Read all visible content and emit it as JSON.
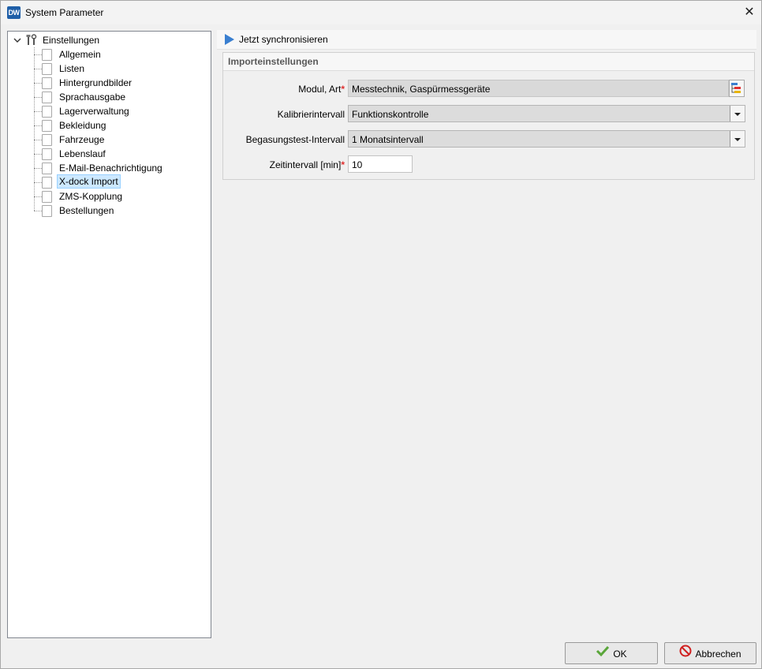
{
  "window": {
    "app_icon_text": "DW",
    "title": "System Parameter",
    "close_glyph": "✕"
  },
  "tree": {
    "root": {
      "label": "Einstellungen",
      "icon": "tools-icon",
      "expanded": true
    },
    "items": [
      {
        "label": "Allgemein"
      },
      {
        "label": "Listen"
      },
      {
        "label": "Hintergrundbilder"
      },
      {
        "label": "Sprachausgabe"
      },
      {
        "label": "Lagerverwaltung"
      },
      {
        "label": "Bekleidung"
      },
      {
        "label": "Fahrzeuge"
      },
      {
        "label": "Lebenslauf"
      },
      {
        "label": "E-Mail-Benachrichtigung"
      },
      {
        "label": "X-dock Import",
        "selected": true
      },
      {
        "label": "ZMS-Kopplung"
      },
      {
        "label": "Bestellungen"
      }
    ]
  },
  "toolbar": {
    "sync_label": "Jetzt synchronisieren"
  },
  "group": {
    "title": "Importeinstellungen",
    "required_mark": "*",
    "fields": {
      "modul_art": {
        "label": "Modul, Art",
        "value": "Messtechnik, Gaspürmessgeräte"
      },
      "kalibrierintervall": {
        "label": "Kalibrierintervall",
        "value": "Funktionskontrolle"
      },
      "begasungstest": {
        "label": "Begasungstest-Intervall",
        "value": "1 Monatsintervall"
      },
      "zeitintervall": {
        "label": "Zeitintervall [min]",
        "value": "10"
      }
    }
  },
  "buttons": {
    "ok": "OK",
    "cancel": "Abbrechen"
  },
  "colors": {
    "accent": "#3a7fd0",
    "required": "#e03030",
    "selection": "#cce8ff"
  }
}
